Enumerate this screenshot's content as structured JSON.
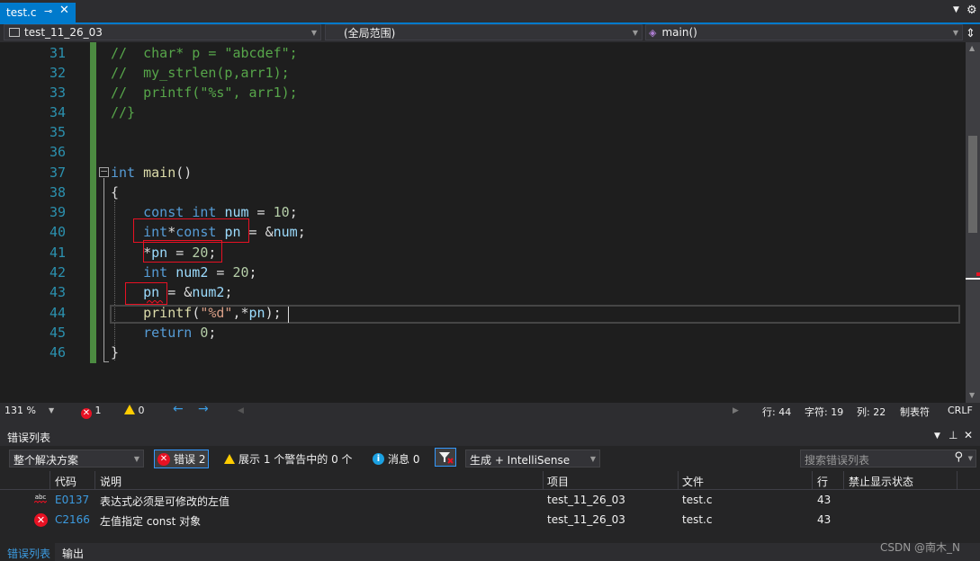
{
  "tab": {
    "title": "test.c",
    "pin_icon": "pin-icon",
    "close_icon": "close-icon"
  },
  "navbar": {
    "project": "test_11_26_03",
    "scope": "(全局范围)",
    "member": "main()"
  },
  "editor": {
    "line_numbers": [
      "31",
      "32",
      "33",
      "34",
      "35",
      "36",
      "37",
      "38",
      "39",
      "40",
      "41",
      "42",
      "43",
      "44",
      "45",
      "46"
    ],
    "code_lines": [
      "//  char* p = \"abcdef\";",
      "//  my_strlen(p,arr1);",
      "//  printf(\"%s\", arr1);",
      "//}",
      "",
      "",
      "int main()",
      "{",
      "    const int num = 10;",
      "    int*const pn = &num;",
      "    *pn = 20;",
      "    int num2 = 20;",
      "    pn = &num2;",
      "    printf(\"%d\",*pn);",
      "    return 0;",
      "}"
    ],
    "current_line": "44"
  },
  "status": {
    "zoom": "131 %",
    "errors": "1",
    "warnings": "0",
    "line": "行: 44",
    "char": "字符: 19",
    "col": "列: 22",
    "indent": "制表符",
    "eol": "CRLF"
  },
  "error_panel": {
    "title": "错误列表",
    "scope_dropdown": "整个解决方案",
    "errors_btn": "错误 2",
    "warnings_btn": "展示 1 个警告中的 0 个",
    "messages_btn": "消息 0",
    "build_dropdown": "生成 + IntelliSense",
    "search_placeholder": "搜索错误列表",
    "columns": [
      "代码",
      "说明",
      "项目",
      "文件",
      "行",
      "禁止显示状态"
    ],
    "rows": [
      {
        "icon": "intellisense-error-icon",
        "code": "E0137",
        "desc": "表达式必须是可修改的左值",
        "project": "test_11_26_03",
        "file": "test.c",
        "line": "43",
        "suppress": ""
      },
      {
        "icon": "error-icon",
        "code": "C2166",
        "desc": "左值指定 const 对象",
        "project": "test_11_26_03",
        "file": "test.c",
        "line": "43",
        "suppress": ""
      }
    ]
  },
  "bottom_tabs": [
    "错误列表",
    "输出"
  ],
  "watermark": "CSDN @南木_N",
  "colors": {
    "accent": "#007acc",
    "keyword": "#569cd6",
    "comment": "#57a64a",
    "string": "#d69d85",
    "number": "#b5cea8",
    "error": "#e81123",
    "highlight_box": "#e81123"
  }
}
